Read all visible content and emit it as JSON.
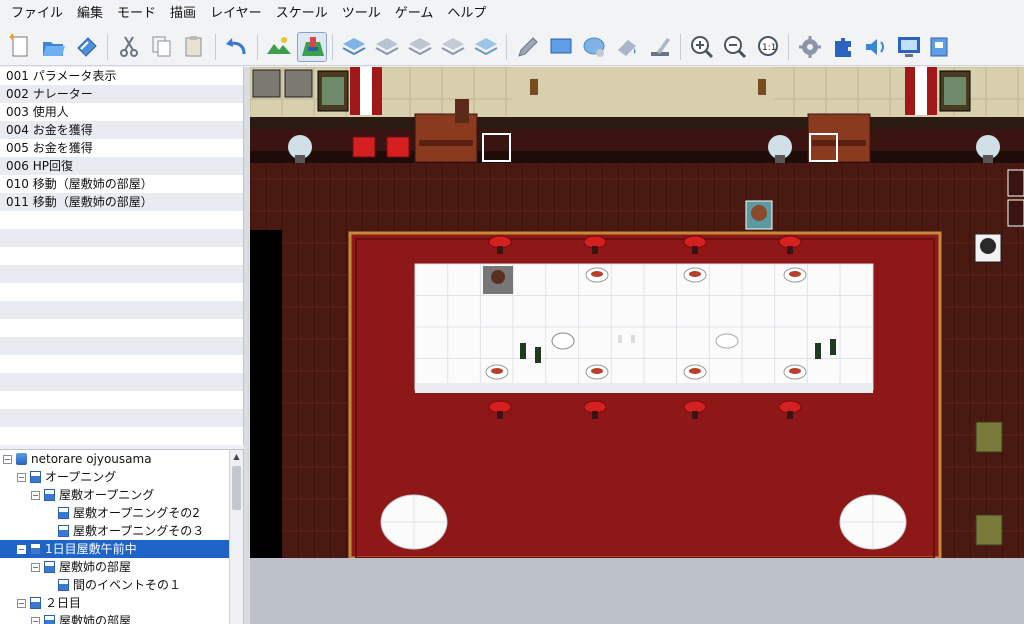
{
  "menu": [
    "ファイル",
    "編集",
    "モード",
    "描画",
    "レイヤー",
    "スケール",
    "ツール",
    "ゲーム",
    "ヘルプ"
  ],
  "toolbar": {
    "groups": [
      [
        "new-project-icon",
        "open-project-icon",
        "save-project-icon"
      ],
      [
        "cut-icon",
        "copy-icon",
        "paste-icon"
      ],
      [
        "undo-icon"
      ],
      [
        "map-layer-icon",
        "event-layer-icon"
      ],
      [
        "layer-a-icon",
        "layer-b-icon",
        "layer-c-icon",
        "layer-d-icon",
        "layer-e-icon"
      ],
      [
        "pencil-icon",
        "rectangle-icon",
        "ellipse-icon",
        "fill-icon",
        "shadow-pen-icon"
      ],
      [
        "zoom-in-icon",
        "zoom-out-icon",
        "zoom-actual-icon"
      ],
      [
        "database-icon",
        "plugin-icon",
        "sound-test-icon",
        "event-searcher-icon",
        "resource-manager-icon"
      ]
    ],
    "active": "event-layer-icon"
  },
  "events": [
    "001 パラメータ表示",
    "002 ナレーター",
    "003 使用人",
    "004 お金を獲得",
    "005 お金を獲得",
    "006 HP回復",
    "010 移動（屋敷姉の部屋）",
    "011 移動（屋敷姉の部屋）"
  ],
  "tree": [
    {
      "label": "netorare ojyousama",
      "level": 0,
      "toggle": "−",
      "icon": "root",
      "selected": false
    },
    {
      "label": "オープニング",
      "level": 1,
      "toggle": "−",
      "icon": "child",
      "selected": false
    },
    {
      "label": "屋敷オープニング",
      "level": 2,
      "toggle": "−",
      "icon": "child",
      "selected": false
    },
    {
      "label": "屋敷オープニングその2",
      "level": 3,
      "toggle": "",
      "icon": "child",
      "selected": false
    },
    {
      "label": "屋敷オープニングその３",
      "level": 3,
      "toggle": "",
      "icon": "child",
      "selected": false
    },
    {
      "label": "1日目屋敷午前中",
      "level": 1,
      "toggle": "−",
      "icon": "child",
      "selected": true
    },
    {
      "label": "屋敷姉の部屋",
      "level": 2,
      "toggle": "−",
      "icon": "child",
      "selected": false
    },
    {
      "label": "間のイベントその１",
      "level": 3,
      "toggle": "",
      "icon": "child",
      "selected": false
    },
    {
      "label": "２日目",
      "level": 1,
      "toggle": "−",
      "icon": "child",
      "selected": false
    },
    {
      "label": "屋敷姉の部屋",
      "level": 2,
      "toggle": "−",
      "icon": "child",
      "selected": false
    }
  ],
  "tree_scroll": {
    "up": "▲"
  },
  "colors": {
    "selection": "#1e64c8",
    "carpet": "#8e1717",
    "wall": "#d8cfae",
    "floor": "#4a1a12"
  }
}
